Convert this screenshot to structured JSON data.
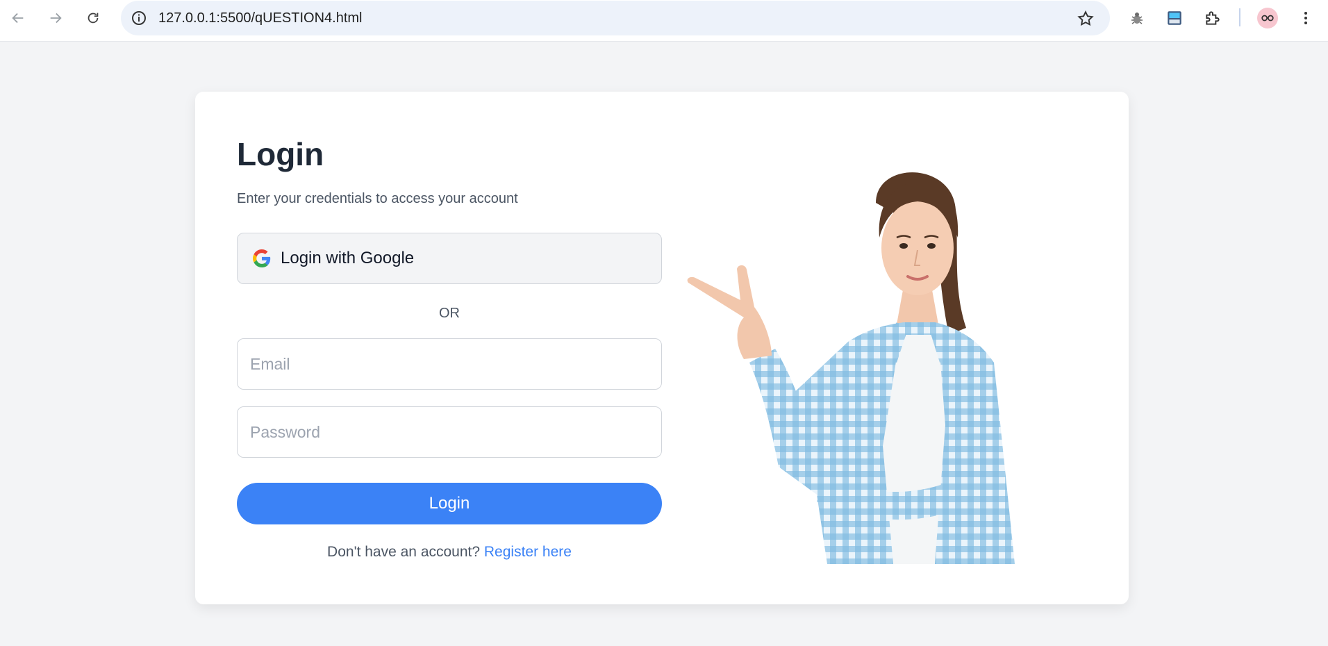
{
  "browser": {
    "url": "127.0.0.1:5500/qUESTION4.html"
  },
  "login": {
    "title": "Login",
    "subtitle": "Enter your credentials to access your account",
    "google_button": "Login with Google",
    "divider": "OR",
    "email_placeholder": "Email",
    "password_placeholder": "Password",
    "submit": "Login",
    "register_prompt": "Don't have an account?",
    "register_link": "Register here"
  },
  "colors": {
    "primary": "#3b82f6",
    "background": "#f3f4f6",
    "shirt": "#6fb0d6"
  }
}
